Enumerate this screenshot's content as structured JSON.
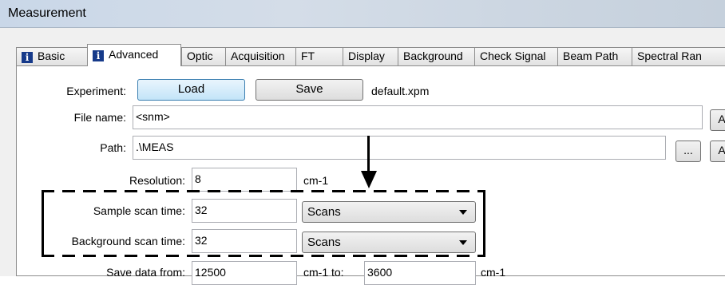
{
  "window": {
    "title": "Measurement"
  },
  "tabs": [
    {
      "label": "Basic",
      "icon": "info-icon"
    },
    {
      "label": "Advanced",
      "icon": "info-icon"
    },
    {
      "label": "Optic"
    },
    {
      "label": "Acquisition"
    },
    {
      "label": "FT"
    },
    {
      "label": "Display"
    },
    {
      "label": "Background"
    },
    {
      "label": "Check Signal"
    },
    {
      "label": "Beam Path"
    },
    {
      "label": "Spectral Ran"
    }
  ],
  "experiment": {
    "label": "Experiment:",
    "load_label": "Load",
    "save_label": "Save",
    "file": "default.xpm"
  },
  "file_name": {
    "label": "File name:",
    "value": "<snm>",
    "button": "A"
  },
  "path": {
    "label": "Path:",
    "value": ".\\MEAS",
    "browse": "...",
    "button": "A"
  },
  "resolution": {
    "label": "Resolution:",
    "value": "8",
    "unit": "cm-1"
  },
  "sample_scan": {
    "label": "Sample scan time:",
    "value": "32",
    "unit": "Scans"
  },
  "background_scan": {
    "label": "Background scan time:",
    "value": "32",
    "unit": "Scans"
  },
  "save_data": {
    "label": "Save data from:",
    "from": "12500",
    "to_label": "cm-1 to:",
    "to": "3600",
    "unit": "cm-1"
  }
}
